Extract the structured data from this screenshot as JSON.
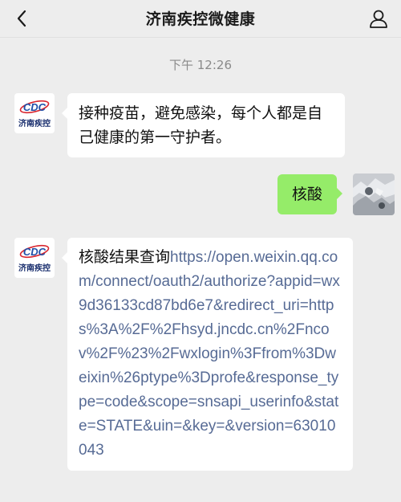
{
  "header": {
    "title": "济南疾控微健康",
    "back_icon": "chevron-left-icon",
    "profile_icon": "person-icon"
  },
  "chat": {
    "timestamp": "下午 12:26",
    "sender_avatar_label": "济南疾控",
    "sender_avatar_logo": "CDC",
    "messages": [
      {
        "from": "official",
        "text": "接种疫苗，避免感染，每个人都是自己健康的第一守护者。"
      },
      {
        "from": "user",
        "text": "核酸"
      },
      {
        "from": "official",
        "text": "核酸结果查询",
        "link": "https://open.weixin.qq.com/connect/oauth2/authorize?appid=wx9d36133cd87bd6e7&redirect_uri=https%3A%2F%2Fhsyd.jncdc.cn%2Fncov%2F%23%2Fwxlogin%3Ffrom%3Dweixin%26ptype%3Dprofe&response_type=code&scope=snsapi_userinfo&state=STATE&uin=&key=&version=63010043"
      }
    ]
  },
  "colors": {
    "background": "#ededed",
    "bubble_in": "#ffffff",
    "bubble_out": "#95ec69",
    "link": "#576b95",
    "cdc_blue": "#1f4fa8",
    "cdc_red": "#d8262f"
  }
}
